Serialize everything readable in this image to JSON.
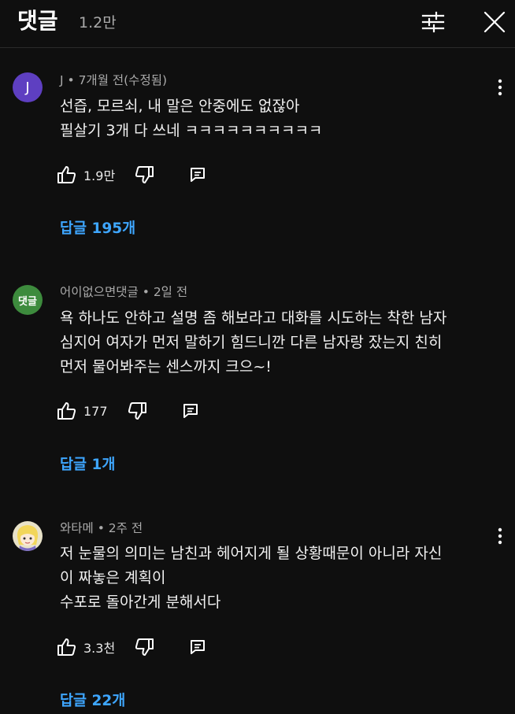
{
  "header": {
    "title": "댓글",
    "count": "1.2만",
    "filter_icon": "sliders-icon",
    "close_icon": "close-icon"
  },
  "comments": [
    {
      "avatar_letter": "J",
      "avatar_color": "#5e3fc1",
      "author": "J",
      "meta": "J • 7개월 전(수정됨)",
      "text": "선즙, 모르쇠, 내 말은 안중에도 없잖아\n필살기 3개 다 쓰네 ㅋㅋㅋㅋㅋㅋㅋㅋㅋㅋ",
      "likes": "1.9만",
      "replies": "답글 195개"
    },
    {
      "avatar_text": "댓글",
      "avatar_color": "#3d8b3d",
      "meta": "어이없으면댓글 • 2일 전",
      "text": "욕 하나도 안하고 설명 좀 해보라고 대화를 시도하는 착한 남자\n심지어 여자가 먼저 말하기 힘드니깐 다른 남자랑 잤는지 친히\n먼저 물어봐주는 센스까지 크으~!",
      "likes": "177",
      "replies": "답글 1개"
    },
    {
      "avatar_color": "#e8e2c8",
      "avatar_icon": "anime-character-avatar",
      "meta": "와타메 • 2주 전",
      "text": "저 눈물의 의미는 남친과 헤어지게 될 상황때문이 아니라 자신\n이 짜놓은 계획이\n수포로 돌아간게 분해서다",
      "likes": "3.3천",
      "replies": "답글 22개"
    }
  ],
  "colors": {
    "background": "#0f0f0f",
    "link": "#3ea6ff",
    "meta": "#aaaaaa"
  }
}
